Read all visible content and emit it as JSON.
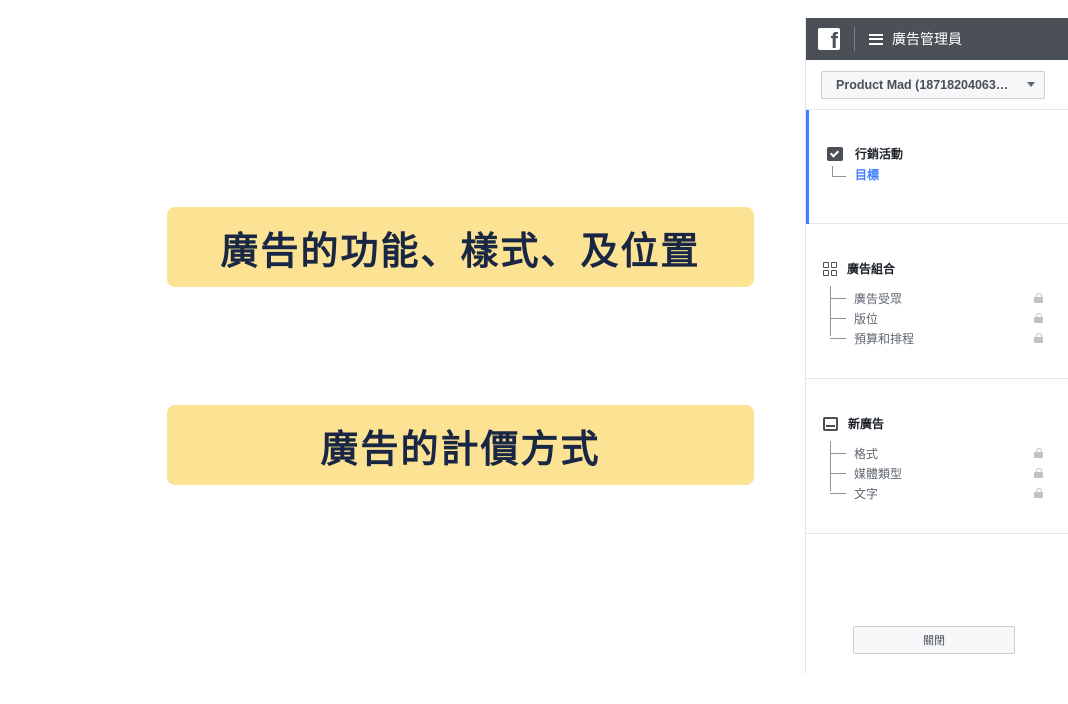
{
  "slide": {
    "callout_1": "廣告的功能、樣式、及位置",
    "callout_2": "廣告的計價方式"
  },
  "header": {
    "logo_letter": "f",
    "title": "廣告管理員"
  },
  "account": {
    "selected": "Product Mad (18718204063…"
  },
  "nav": {
    "campaign": {
      "label": "行銷活動",
      "items": [
        {
          "label": "目標",
          "active": true
        }
      ]
    },
    "ad_set": {
      "label": "廣告組合",
      "items": [
        {
          "label": "廣告受眾",
          "locked": true
        },
        {
          "label": "版位",
          "locked": true
        },
        {
          "label": "預算和排程",
          "locked": true
        }
      ]
    },
    "ad": {
      "label": "新廣告",
      "items": [
        {
          "label": "格式",
          "locked": true
        },
        {
          "label": "媒體類型",
          "locked": true
        },
        {
          "label": "文字",
          "locked": true
        }
      ]
    }
  },
  "footer": {
    "close_label": "關閉"
  },
  "colors": {
    "callout_bg": "#fbe393",
    "callout_text": "#1a2744",
    "accent": "#4080ff",
    "topbar": "#4b4f56"
  }
}
